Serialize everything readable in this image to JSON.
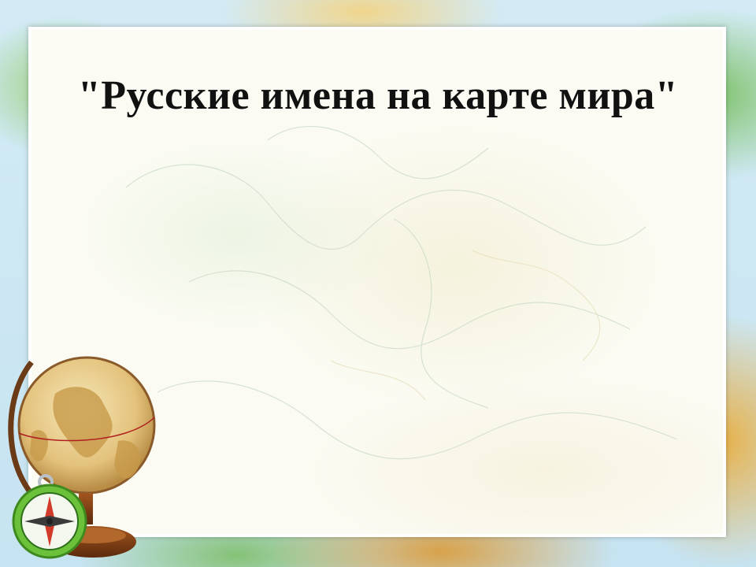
{
  "slide": {
    "title": "\"Русские имена на карте мира\"",
    "background": "world-map-background",
    "colors": {
      "frame": "#ffffff",
      "panel": "#fbfbf3",
      "ocean": "#c6e3f1",
      "title": "#111111"
    }
  },
  "decorations": {
    "globe_icon": "globe-icon",
    "compass_icon": "compass-icon"
  }
}
